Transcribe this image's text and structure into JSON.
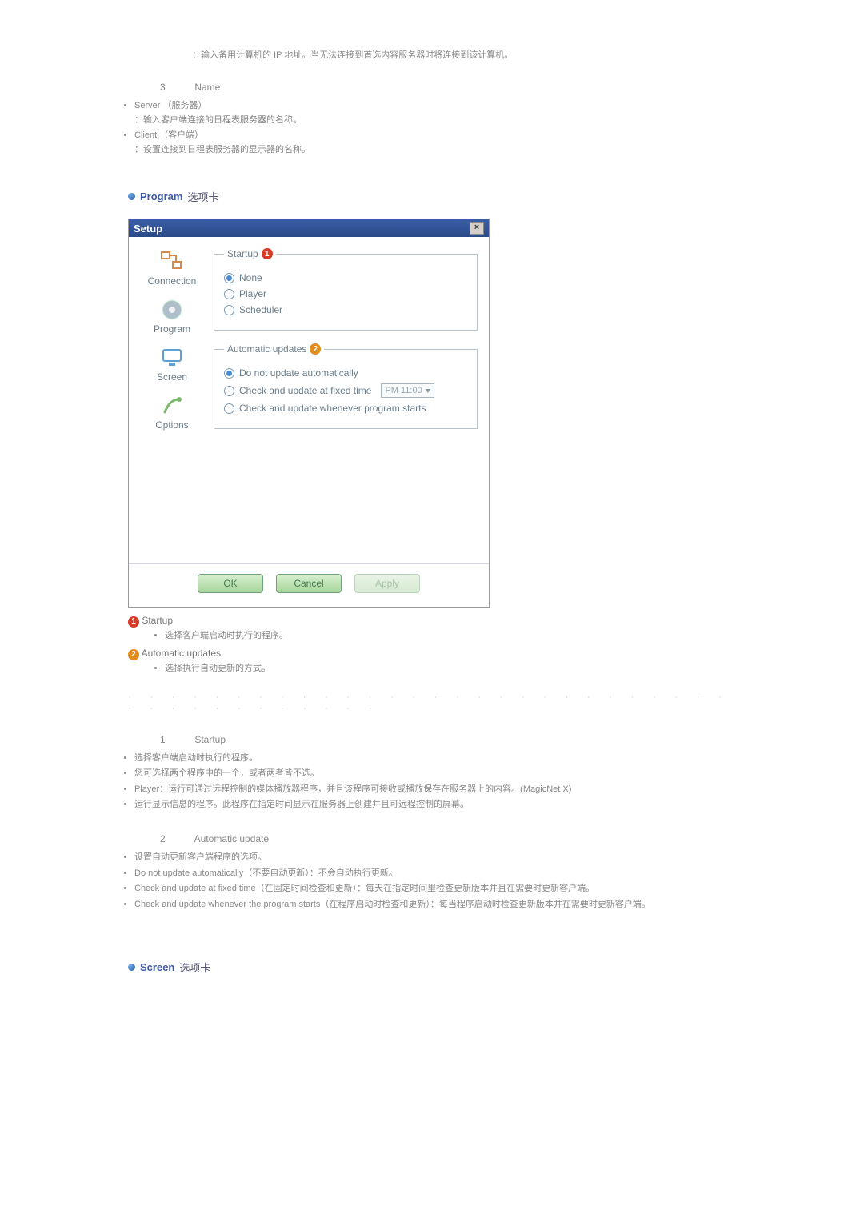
{
  "intro": {
    "line1": "：输入备用计算机的 IP 地址。当无法连接到首选内容服务器时将连接到该计算机。"
  },
  "name_section": {
    "index": "3",
    "title": "Name",
    "server_label": "Server",
    "server_paren": "（服务器）",
    "server_desc": "：输入客户端连接的日程表服务器的名称。",
    "client_label": "Client",
    "client_paren": "（客户端）",
    "client_desc": "：设置连接到日程表服务器的显示器的名称。"
  },
  "program_tab": {
    "head_strong": "Program",
    "head_rest": "选项卡",
    "dialog": {
      "title": "Setup",
      "side": {
        "connection": "Connection",
        "program": "Program",
        "screen": "Screen",
        "options": "Options"
      },
      "startup": {
        "legend": "Startup",
        "badge": "1",
        "opts": {
          "none": "None",
          "player": "Player",
          "scheduler": "Scheduler"
        },
        "selected": "none"
      },
      "updates": {
        "legend": "Automatic updates",
        "badge": "2",
        "opts": {
          "noauto": "Do not update automatically",
          "fixed": "Check and update at fixed time",
          "onstart": "Check and update whenever program starts"
        },
        "time": "PM 11:00",
        "selected": "noauto"
      },
      "buttons": {
        "ok": "OK",
        "cancel": "Cancel",
        "apply": "Apply"
      }
    },
    "legend_startup": "Startup",
    "legend_startup_desc": "选择客户端启动时执行的程序。",
    "legend_updates": "Automatic updates",
    "legend_updates_desc": "选择执行自动更新的方式。"
  },
  "startup_detail": {
    "index": "1",
    "title": "Startup",
    "b1": "选择客户端启动时执行的程序。",
    "b2": "您可选择两个程序中的一个，或者两者皆不选。",
    "b3a": "Player",
    "b3b": "：运行可通过远程控制的媒体播放器程序，并且该程序可接收或播放保存在服务器上的内容。(MagicNet X)",
    "b4": "运行显示信息的程序。此程序在指定时间显示在服务器上创建并且可远程控制的屏幕。"
  },
  "autoupdate_detail": {
    "index": "2",
    "title": "Automatic update",
    "b1": "设置自动更新客户端程序的选项。",
    "b2a": "Do not update automatically",
    "b2b": "（不要自动更新）：不会自动执行更新。",
    "b3a": "Check and update at fixed time",
    "b3b": "（在固定时间检查和更新）：每天在指定时间里检查更新版本并且在需要时更新客户端。",
    "b4a": "Check and update whenever the program starts",
    "b4b": "（在程序启动时检查和更新）：每当程序启动时检查更新版本并在需要时更新客户端。"
  },
  "screen_tab": {
    "head_strong": "Screen",
    "head_rest": "选项卡"
  }
}
